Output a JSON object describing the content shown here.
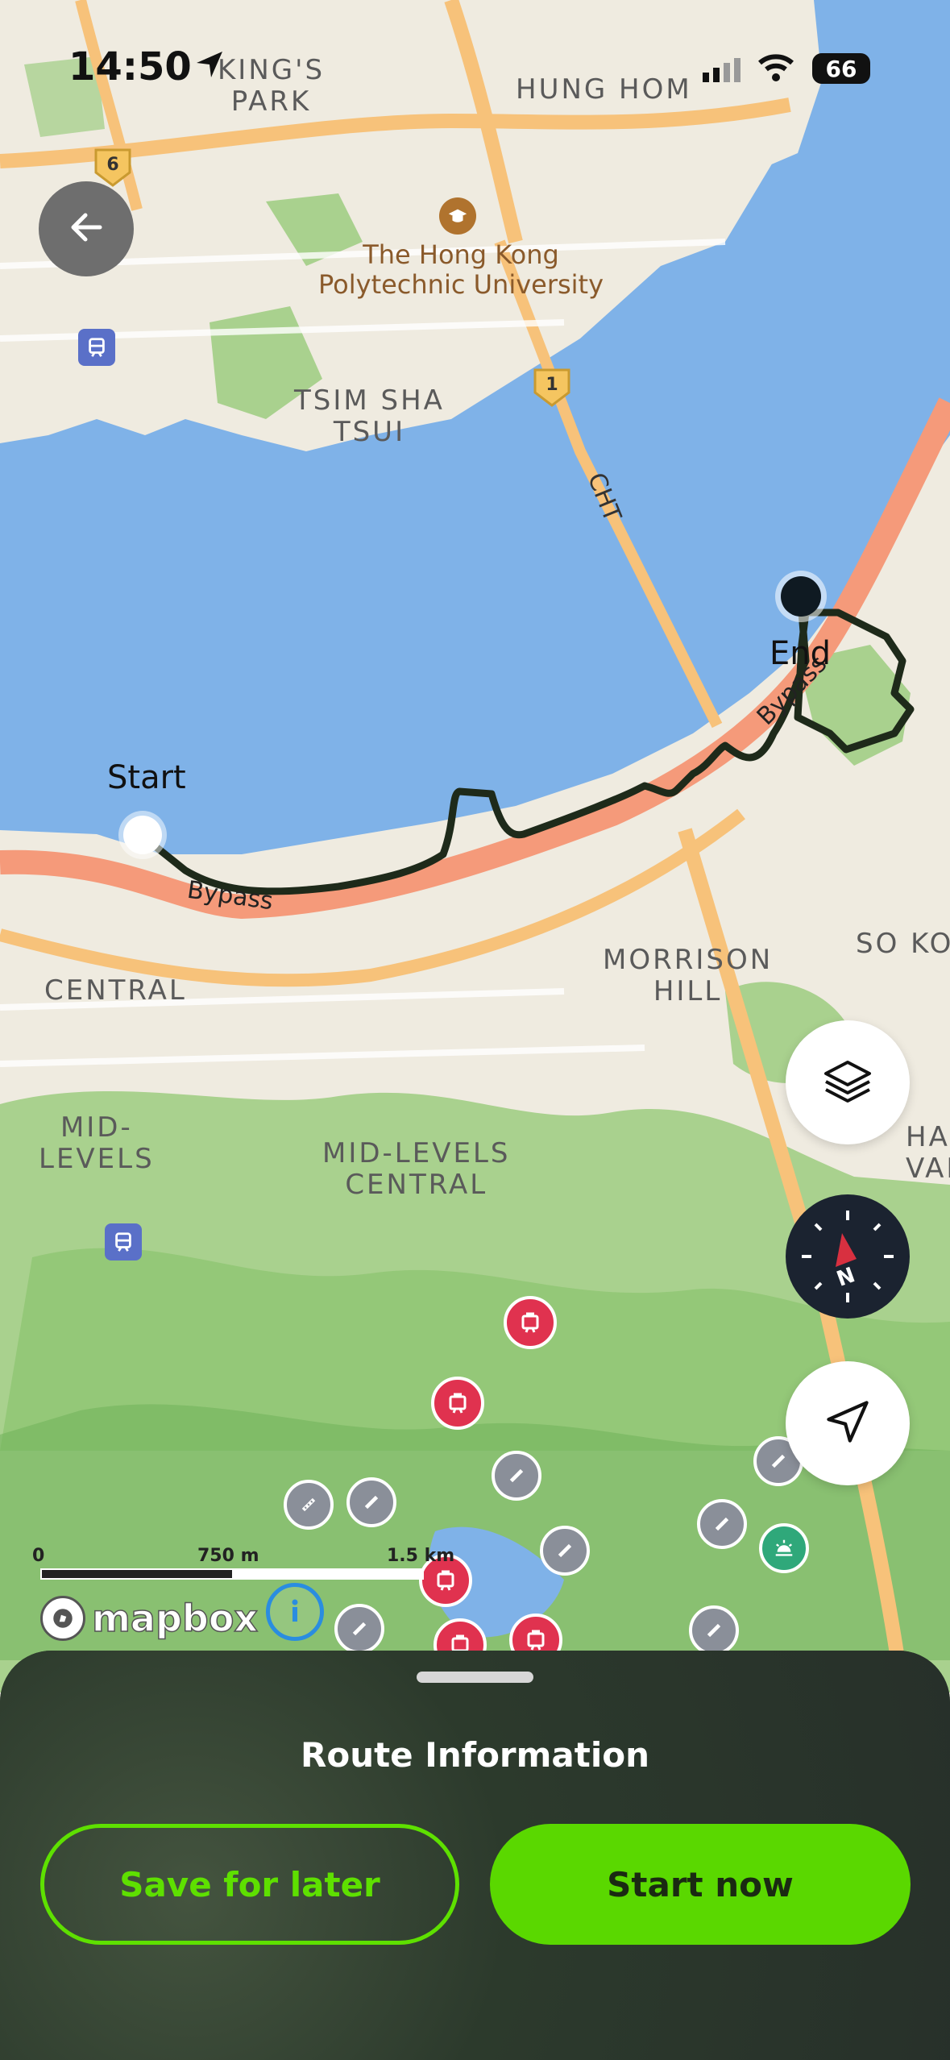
{
  "status_bar": {
    "time": "14:50",
    "battery": "66"
  },
  "map": {
    "place_labels": {
      "kings_park": "KING'S\nPARK",
      "hung_hom": "HUNG HOM",
      "polyu": "The Hong Kong\nPolytechnic University",
      "tsim_sha_tsui": "TSIM SHA\nTSUI",
      "central": "CENTRAL",
      "mid_levels": "MID-\nLEVELS",
      "mid_levels_central": "MID-LEVELS\nCENTRAL",
      "morrison_hill": "MORRISON\nHILL",
      "so_kon": "SO KON",
      "ha_val": "HA\nVAL"
    },
    "road_labels": {
      "cht": "CHT",
      "bypass_1": "Bypass",
      "bypass_2": "Bypass"
    },
    "route_shields": {
      "shield_6": "6",
      "shield_1": "1"
    },
    "route_markers": {
      "start": "Start",
      "end": "End"
    },
    "scale_bar": {
      "zero": "0",
      "mid": "750 m",
      "max": "1.5 km"
    },
    "attribution": "mapbox"
  },
  "controls": {
    "back_icon": "arrow-left-icon",
    "layers_icon": "layers-icon",
    "compass_icon": "compass-icon",
    "compass_letter": "N",
    "locate_icon": "navigation-arrow-icon",
    "info_icon": "info-icon"
  },
  "bottom_sheet": {
    "title": "Route Information",
    "save_button": "Save for later",
    "start_button": "Start now"
  },
  "colors": {
    "water": "#7fb2e8",
    "land": "#efebe0",
    "park": "#a9d18e",
    "major_road": "#f7c27a",
    "highway": "#f59a7a",
    "route_line": "#1e2a1a",
    "accent_green": "#5ad800"
  }
}
